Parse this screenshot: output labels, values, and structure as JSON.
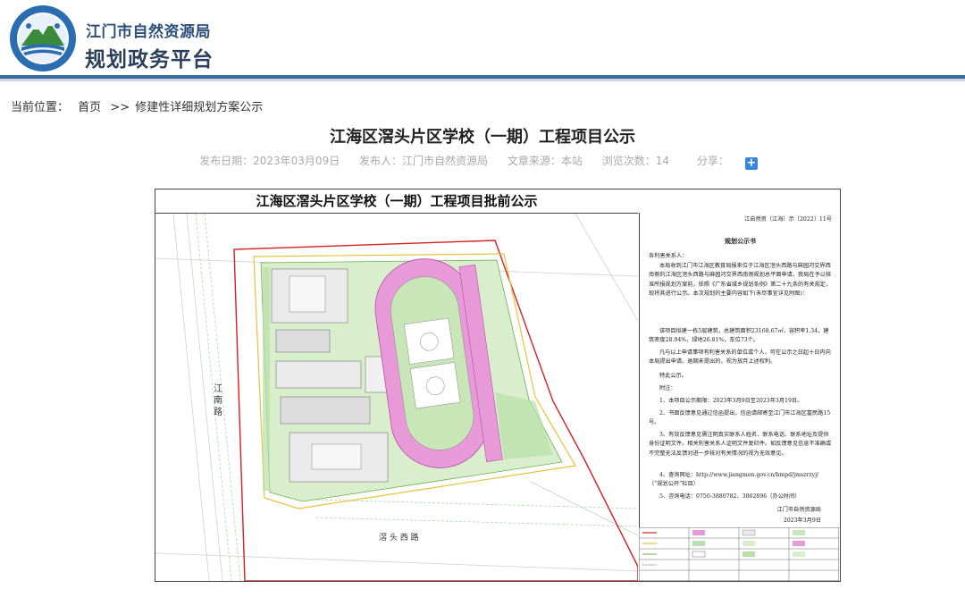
{
  "header": {
    "org_name": "江门市自然资源局",
    "platform_name": "规划政务平台",
    "logo_text": "江门自然资源"
  },
  "breadcrumb": {
    "label": "当前位置：",
    "home": "首页",
    "separator": ">>",
    "current": "修建性详细规划方案公示"
  },
  "article": {
    "title": "江海区滘头片区学校（一期）工程项目公示",
    "publish_date": "发布日期：2023年03月09日",
    "publisher": "发布人：江门市自然资源局",
    "source": "文章来源：本站",
    "views": "浏览次数：14",
    "share": "分享："
  },
  "poster": {
    "title": "江海区滘头片区学校（一期）工程项目批前公示",
    "doc_no": "江自然资（江海）示〔2022〕11号",
    "notice_title": "规划公示书",
    "salutation": "各利害关系人：",
    "para1": "本局收到江门市江海区教育局报来位于江海区滘头西路与麻园河交界西南侧的江海区滘头西路与麻园河交界西南侧规划总平面申请。我局在予以核准所报规划方案前，依照《广东省城乡规划条例》第二十九条的有关规定，现将其进行公示。本次规划的主要内容如下(未尽事宜详见附图)：",
    "para2": "该项目拟建一栋5层建筑，总建筑面积23168.67㎡，容积率1.34，建筑密度28.94%，绿地26.81%，车位73个。",
    "para3": "凡与以上申请事项有利害关系的单位或个人，可在公示之日起十日内向本局提出申请。逾期未提出的，视为放弃上述权利。",
    "para4": "特此公示。",
    "attach_label": "附注：",
    "note1": "1、本项目公示期限：2023年3月9日至2023年3月19日。",
    "note2": "2、书面反馈意见通过信函提出，信函请邮寄至江门市江海区富民路15号。",
    "note3": "3、有效反馈意见需注明真实联系人姓名、联系电话、联系地址及提供身份证明文件。相关利害关系人证明文件复印件。如反馈意见信息不准确或不完整无法反馈对进一步核对有关情况的视为无效意见。",
    "note4": "4、查询网址：http://www.jiangmen.gov.cn/bmpd/jmszrzyj/（“规划公开”栏目）",
    "note5": "5、咨询电话：0750-3880782、3862896（办公时间）",
    "signature": "江门市自然资源局",
    "sign_date": "2023年3月9日",
    "map_label_road_west": "江 南 路",
    "map_label_road_south": "滘 头 西 路"
  },
  "colors": {
    "brand_blue": "#3b6a9c",
    "title_blue": "#2b4f7a",
    "track_pink": "#e89ad8",
    "site_red": "#d42020",
    "green_area": "#b8e0a8"
  }
}
